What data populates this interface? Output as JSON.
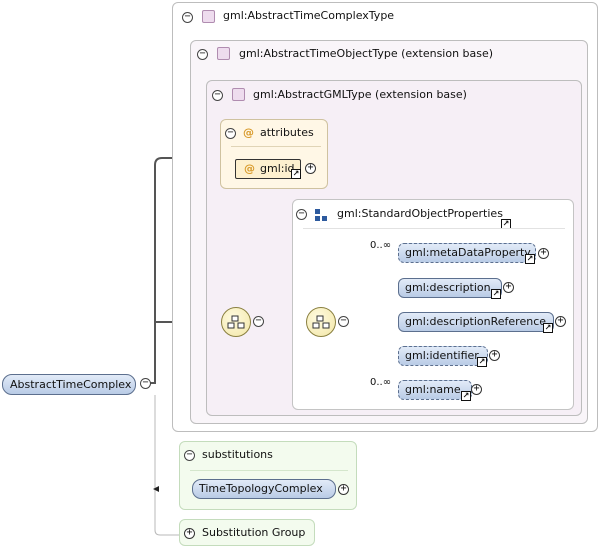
{
  "complex_type": {
    "name": "gml:AbstractTimeComplexType"
  },
  "object_type": {
    "name": "gml:AbstractTimeObjectType (extension base)"
  },
  "gml_type": {
    "name": "gml:AbstractGMLType (extension base)"
  },
  "attributes": {
    "title": "attributes",
    "at_symbol": "@",
    "id_attr": "gml:id"
  },
  "standard_props": {
    "name": "gml:StandardObjectProperties"
  },
  "elements": [
    {
      "label": "gml:metaDataProperty",
      "cardinality": "0..∞"
    },
    {
      "label": "gml:description",
      "cardinality": ""
    },
    {
      "label": "gml:descriptionReference",
      "cardinality": ""
    },
    {
      "label": "gml:identifier",
      "cardinality": ""
    },
    {
      "label": "gml:name",
      "cardinality": "0..∞"
    }
  ],
  "root": {
    "label": "AbstractTimeComplex"
  },
  "substitutions": {
    "title": "substitutions",
    "item": "TimeTopologyComplex"
  },
  "substitution_group": {
    "title": "Substitution Group"
  },
  "glyphs": {
    "minus": "−",
    "plus": "+",
    "ref": "↗"
  }
}
